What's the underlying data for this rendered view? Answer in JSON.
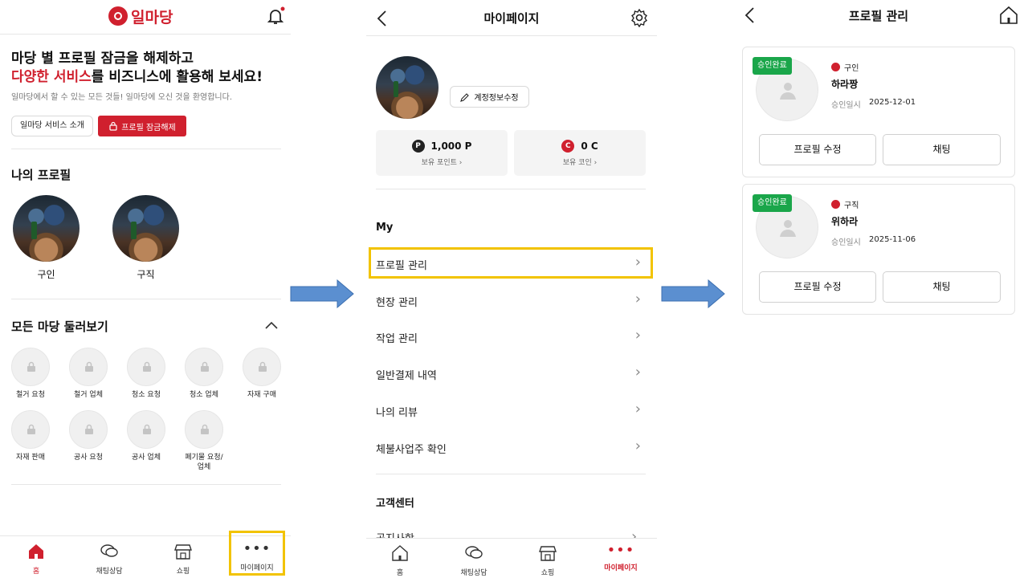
{
  "screen1": {
    "logo_text": "일마당",
    "headline_line1": "마당 별 프로필 잠금을 해제하고",
    "headline_red": "다양한 서비스",
    "headline_rest": "를 비즈니스에 활용해 보세요!",
    "subtext": "일마당에서 할 수 있는 모든 것들! 일마당에 오신 것을 환영합니다.",
    "intro_button": "일마당 서비스 소개",
    "unlock_button": "프로필 잠금해제",
    "my_profile_title": "나의 프로필",
    "profiles": [
      "구인",
      "구직"
    ],
    "browse_title": "모든 마당 둘러보기",
    "madangs": [
      "철거 요청",
      "철거 업체",
      "청소 요청",
      "청소 업체",
      "자재 구매",
      "자재 판매",
      "공사 요청",
      "공사 업체",
      "폐기물 요청/\n업체"
    ],
    "nav": [
      "홈",
      "채팅상담",
      "쇼핑",
      "마이페이지"
    ]
  },
  "screen2": {
    "title": "마이페이지",
    "edit_button": "계정정보수정",
    "points_value": "1,000 P",
    "points_label": "보유 포인트 ›",
    "coins_value": "0 C",
    "coins_label": "보유 코인 ›",
    "my_section": "My",
    "menu": [
      "프로필 관리",
      "현장 관리",
      "작업 관리",
      "일반결제 내역",
      "나의 리뷰",
      "체불사업주 확인"
    ],
    "support_section": "고객센터",
    "support_partial": "공지사항",
    "nav": [
      "홈",
      "채팅상담",
      "쇼핑",
      "마이페이지"
    ]
  },
  "screen3": {
    "title": "프로필 관리",
    "cards": [
      {
        "badge": "승인완료",
        "type": "구인",
        "name": "하라짱",
        "date_label": "승인일시",
        "date": "2025-12-01",
        "edit": "프로필 수정",
        "chat": "채팅"
      },
      {
        "badge": "승인완료",
        "type": "구직",
        "name": "위하라",
        "date_label": "승인일시",
        "date": "2025-11-06",
        "edit": "프로필 수정",
        "chat": "채팅"
      }
    ]
  },
  "colors": {
    "brand_red": "#d0202e",
    "badge_green": "#1aa64a",
    "highlight_yellow": "#f2c300",
    "arrow_blue": "#5b8fd0"
  }
}
